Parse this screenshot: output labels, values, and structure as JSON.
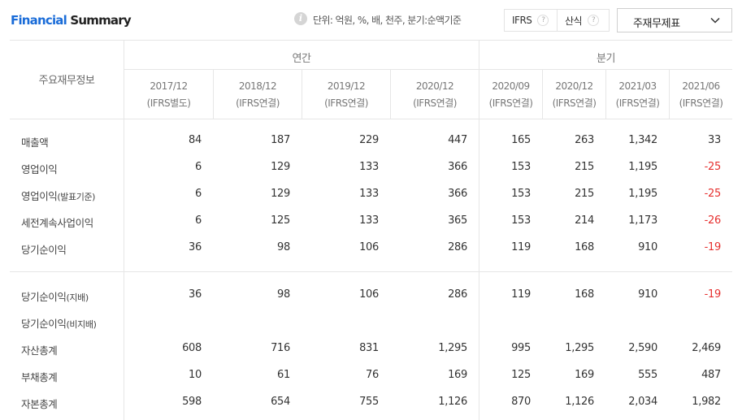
{
  "header": {
    "title_part1": "Financial",
    "title_part2": " Summary",
    "info_icon": "info-icon",
    "unit_text": "단위: 억원, %, 배, 천주, 분기:순액기준",
    "ifrs_label": "IFRS",
    "calc_label": "산식",
    "help_icon": "help-icon",
    "select_value": "주재무제표"
  },
  "table": {
    "row_header": "주요재무정보",
    "groups": {
      "annual": "연간",
      "quarterly": "분기"
    },
    "columns": [
      {
        "period": "2017/12",
        "basis": "(IFRS별도)"
      },
      {
        "period": "2018/12",
        "basis": "(IFRS연결)"
      },
      {
        "period": "2019/12",
        "basis": "(IFRS연결)"
      },
      {
        "period": "2020/12",
        "basis": "(IFRS연결)"
      },
      {
        "period": "2020/09",
        "basis": "(IFRS연결)"
      },
      {
        "period": "2020/12",
        "basis": "(IFRS연결)"
      },
      {
        "period": "2021/03",
        "basis": "(IFRS연결)"
      },
      {
        "period": "2021/06",
        "basis": "(IFRS연결)"
      }
    ],
    "rows": [
      {
        "label": "매출액",
        "sub": "",
        "values": [
          "84",
          "187",
          "229",
          "447",
          "165",
          "263",
          "1,342",
          "33"
        ]
      },
      {
        "label": "영업이익",
        "sub": "",
        "values": [
          "6",
          "129",
          "133",
          "366",
          "153",
          "215",
          "1,195",
          "-25"
        ]
      },
      {
        "label": "영업이익",
        "sub": "(발표기준)",
        "values": [
          "6",
          "129",
          "133",
          "366",
          "153",
          "215",
          "1,195",
          "-25"
        ]
      },
      {
        "label": "세전계속사업이익",
        "sub": "",
        "values": [
          "6",
          "125",
          "133",
          "365",
          "153",
          "214",
          "1,173",
          "-26"
        ]
      },
      {
        "label": "당기순이익",
        "sub": "",
        "values": [
          "36",
          "98",
          "106",
          "286",
          "119",
          "168",
          "910",
          "-19"
        ]
      },
      {
        "label": "당기순이익",
        "sub": "(지배)",
        "values": [
          "36",
          "98",
          "106",
          "286",
          "119",
          "168",
          "910",
          "-19"
        ]
      },
      {
        "label": "당기순이익",
        "sub": "(비지배)",
        "values": [
          "",
          "",
          "",
          "",
          "",
          "",
          "",
          ""
        ]
      },
      {
        "label": "자산총계",
        "sub": "",
        "values": [
          "608",
          "716",
          "831",
          "1,295",
          "995",
          "1,295",
          "2,590",
          "2,469"
        ]
      },
      {
        "label": "부채총계",
        "sub": "",
        "values": [
          "10",
          "61",
          "76",
          "169",
          "125",
          "169",
          "555",
          "487"
        ]
      },
      {
        "label": "자본총계",
        "sub": "",
        "values": [
          "598",
          "654",
          "755",
          "1,126",
          "870",
          "1,126",
          "2,034",
          "1,982"
        ]
      }
    ]
  },
  "colors": {
    "brand_blue": "#1a6cd8",
    "negative": "#e6302f",
    "grid": "#e6e6e6"
  }
}
